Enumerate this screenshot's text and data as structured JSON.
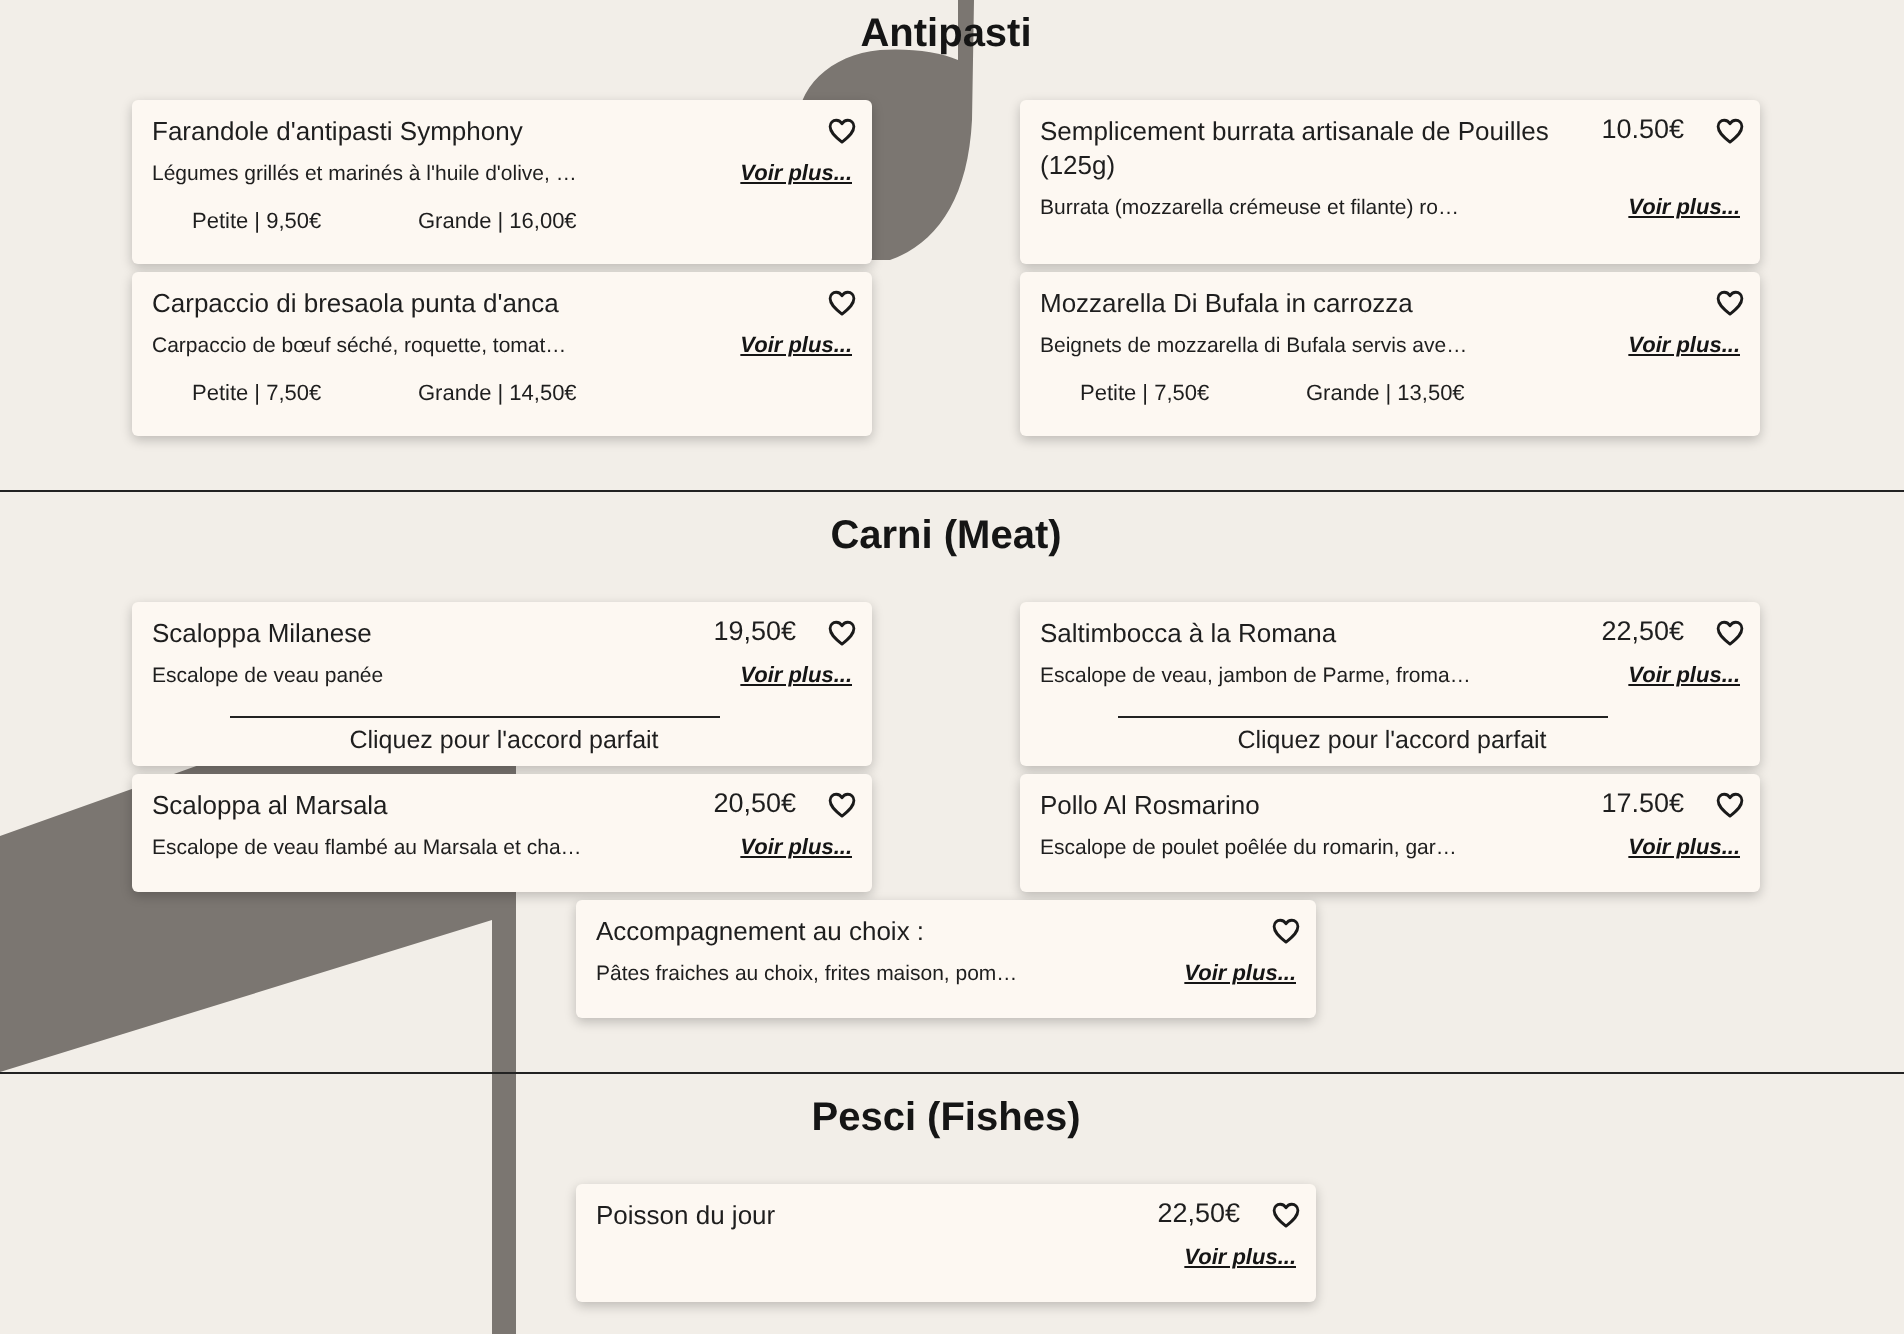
{
  "sections": [
    {
      "title": "Antipasti",
      "items": [
        {
          "name": "Farandole d'antipasti Symphony",
          "description": "Légumes grillés et marinés à l'huile d'olive, …",
          "more": "Voir plus...",
          "sizes": [
            "Petite | 9,50€",
            "Grande | 16,00€"
          ]
        },
        {
          "name": "Semplicement burrata artisanale de Pouilles (125g)",
          "price": "10.50€",
          "description": "Burrata (mozzarella crémeuse et filante) ro…",
          "more": "Voir plus..."
        },
        {
          "name": "Carpaccio di bresaola punta d'anca",
          "description": "Carpaccio de bœuf séché, roquette, tomat…",
          "more": "Voir plus...",
          "sizes": [
            "Petite | 7,50€",
            "Grande | 14,50€"
          ]
        },
        {
          "name": "Mozzarella Di Bufala in carrozza",
          "description": "Beignets de mozzarella di Bufala servis ave…",
          "more": "Voir plus...",
          "sizes": [
            "Petite | 7,50€",
            "Grande | 13,50€"
          ]
        }
      ]
    },
    {
      "title": "Carni (Meat)",
      "items": [
        {
          "name": "Scaloppa Milanese",
          "price": "19,50€",
          "description": "Escalope de veau panée",
          "more": "Voir plus...",
          "pairing_link": "Cliquez pour l'accord parfait"
        },
        {
          "name": "Saltimbocca à la Romana",
          "price": "22,50€",
          "description": "Escalope de veau, jambon de Parme, froma…",
          "more": "Voir plus...",
          "pairing_link": "Cliquez pour l'accord parfait"
        },
        {
          "name": "Scaloppa al Marsala",
          "price": "20,50€",
          "description": "Escalope de veau flambé au Marsala et cha…",
          "more": "Voir plus..."
        },
        {
          "name": "Pollo Al Rosmarino",
          "price": "17.50€",
          "description": "Escalope de poulet poêlée du romarin, gar…",
          "more": "Voir plus..."
        },
        {
          "name": "Accompagnement au choix :",
          "description": "Pâtes fraiches au choix, frites maison, pom…",
          "more": "Voir plus..."
        }
      ]
    },
    {
      "title": "Pesci (Fishes)",
      "items": [
        {
          "name": "Poisson du jour",
          "price": "22,50€",
          "more": "Voir plus..."
        }
      ]
    }
  ]
}
